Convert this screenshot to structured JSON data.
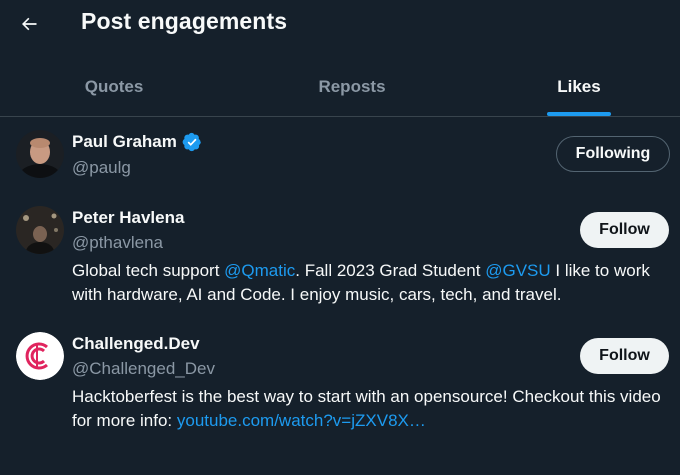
{
  "header": {
    "title": "Post engagements",
    "back_icon": "arrow-left-icon"
  },
  "tabs": [
    {
      "label": "Quotes",
      "active": false
    },
    {
      "label": "Reposts",
      "active": false
    },
    {
      "label": "Likes",
      "active": true
    }
  ],
  "users": [
    {
      "name": "Paul Graham",
      "handle": "@paulg",
      "verified": true,
      "button_label": "Following"
    },
    {
      "name": "Peter Havlena",
      "handle": "@pthavlena",
      "verified": false,
      "button_label": "Follow",
      "bio": {
        "p1": "Global tech support ",
        "m1": "@Qmatic",
        "p2": ". Fall 2023 Grad Student ",
        "m2": "@GVSU",
        "p3": " I like to work with hardware, AI and Code. I enjoy music, cars, tech, and travel."
      }
    },
    {
      "name": "Challenged.Dev",
      "handle": "@Challenged_Dev",
      "verified": false,
      "button_label": "Follow",
      "bio": {
        "p1": "Hacktoberfest is the best way to start with an opensource! Checkout this video for more info: ",
        "link": "youtube.com/watch?v=jZXV8X…"
      }
    }
  ],
  "colors": {
    "background": "#15202b",
    "accent": "#1d9bf0",
    "muted": "#8b98a5",
    "divider": "#38444d"
  }
}
